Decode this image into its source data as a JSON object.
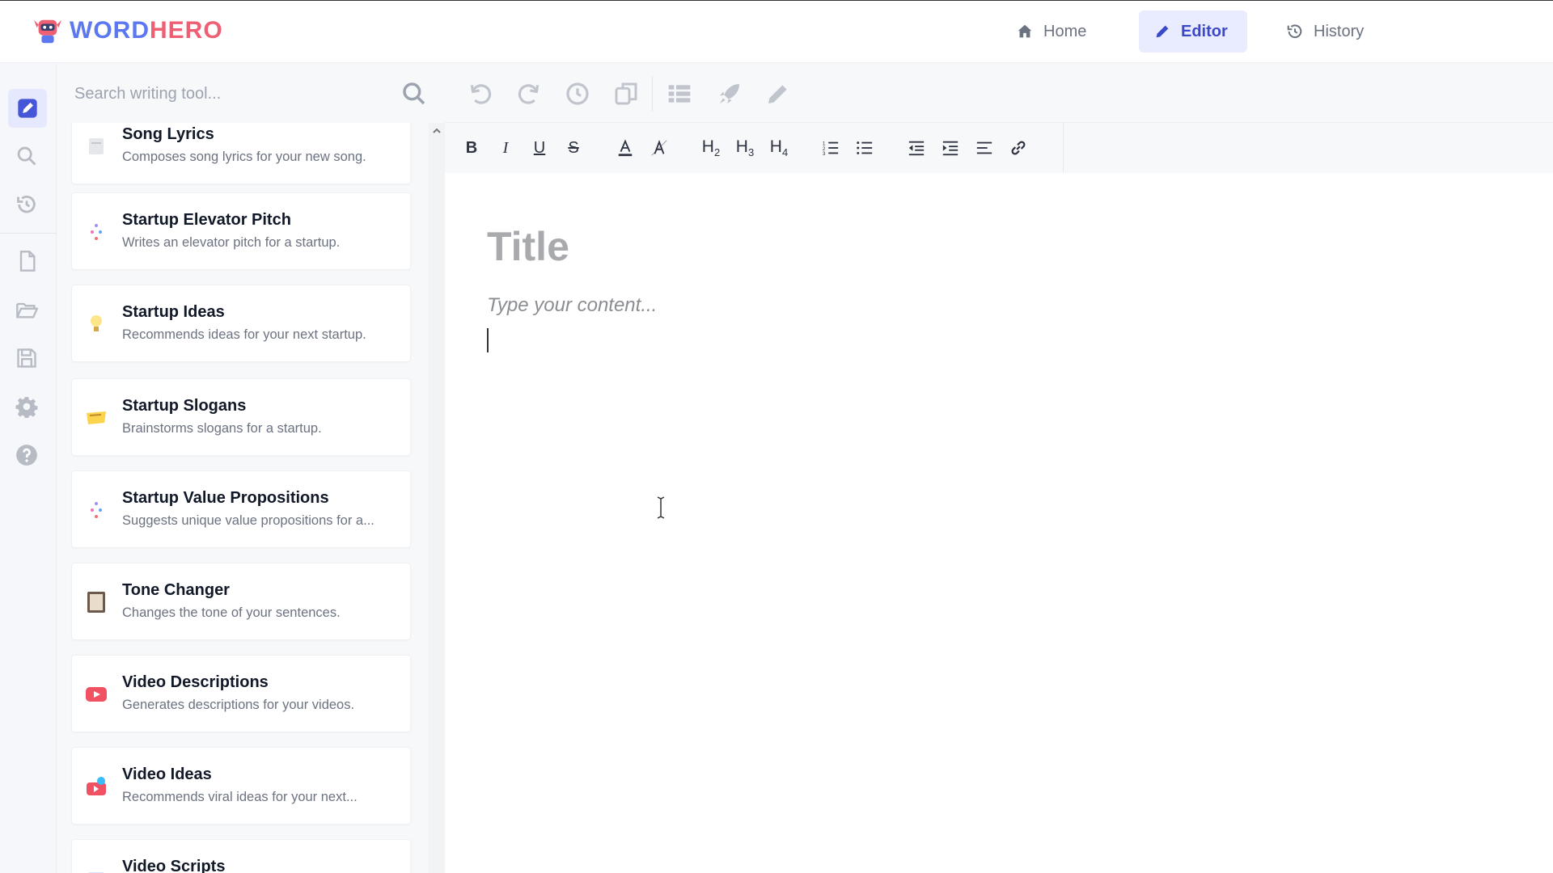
{
  "brand": {
    "part1": "WORD",
    "part2": "HERO"
  },
  "nav": {
    "home": "Home",
    "editor": "Editor",
    "history": "History"
  },
  "search": {
    "placeholder": "Search writing tool..."
  },
  "tools": [
    {
      "title": "Song Lyrics",
      "desc": "Composes song lyrics for your new song.",
      "icon": "music-sheet-icon"
    },
    {
      "title": "Startup Elevator Pitch",
      "desc": "Writes an elevator pitch for a startup.",
      "icon": "sparkle-icon"
    },
    {
      "title": "Startup Ideas",
      "desc": "Recommends ideas for your next startup.",
      "icon": "lightbulb-icon"
    },
    {
      "title": "Startup Slogans",
      "desc": "Brainstorms slogans for a startup.",
      "icon": "banner-icon"
    },
    {
      "title": "Startup Value Propositions",
      "desc": "Suggests unique value propositions for a...",
      "icon": "sparkle-icon"
    },
    {
      "title": "Tone Changer",
      "desc": "Changes the tone of your sentences.",
      "icon": "calculator-icon"
    },
    {
      "title": "Video Descriptions",
      "desc": "Generates descriptions for your videos.",
      "icon": "youtube-icon"
    },
    {
      "title": "Video Ideas",
      "desc": "Recommends viral ideas for your next...",
      "icon": "video-idea-icon"
    },
    {
      "title": "Video Scripts",
      "desc": "",
      "icon": "script-icon"
    }
  ],
  "editor": {
    "title_placeholder": "Title",
    "content_placeholder": "Type your content..."
  },
  "colors": {
    "accent": "#3b49c9",
    "accent_bg": "#e9ecfe",
    "brand_blue": "#5b78f0",
    "brand_red": "#ef5f73"
  }
}
